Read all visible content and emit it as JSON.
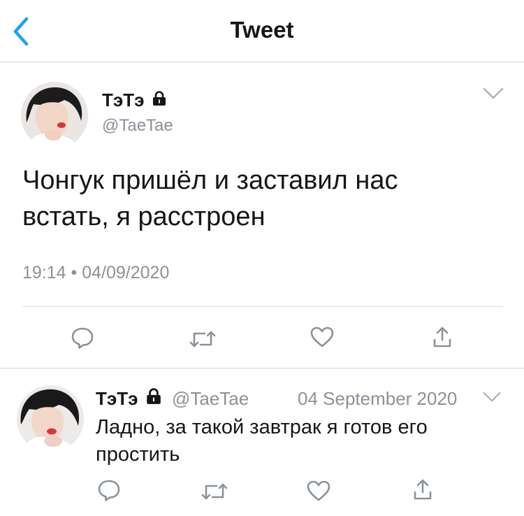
{
  "header": {
    "title": "Tweet"
  },
  "main_tweet": {
    "author_name": "ТэТэ",
    "author_handle": "@TaeTae",
    "text": "Чонгук пришёл и заставил нас встать, я расстроен",
    "time": "19:14",
    "separator": "•",
    "date": "04/09/2020"
  },
  "reply": {
    "author_name": "ТэТэ",
    "author_handle": "@TaeTae",
    "date": "04 September 2020",
    "text": "Ладно, за такой завтрак я готов его простить"
  },
  "icons": [
    "back-chevron",
    "lock",
    "chevron-down",
    "reply",
    "retweet",
    "like",
    "share"
  ],
  "colors": {
    "accent": "#1da1f2",
    "text": "#14171a",
    "muted": "#8a9299",
    "divider": "#d0d4d8"
  }
}
